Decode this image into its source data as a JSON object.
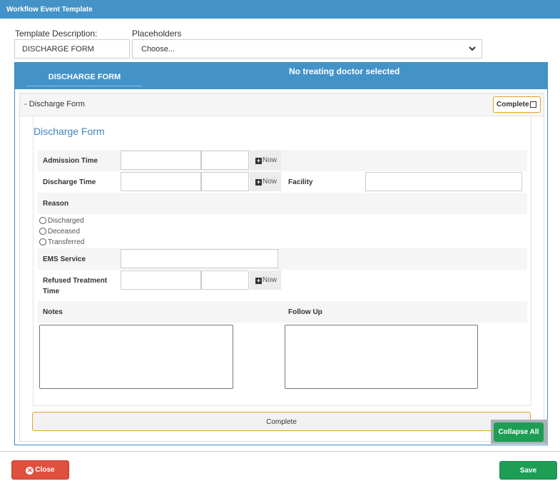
{
  "window": {
    "title": "Workflow Event Template"
  },
  "template": {
    "description_label": "Template Description:",
    "description_value": "DISCHARGE FORM",
    "placeholders_label": "Placeholders",
    "placeholders_value": "Choose..."
  },
  "panel": {
    "tab_label": "DISCHARGE FORM",
    "doctor_status": "No treating doctor selected"
  },
  "form": {
    "header_title": "- Discharge Form",
    "complete_label": "Complete",
    "title": "Discharge Form",
    "fields": {
      "admission_time": "Admission Time",
      "discharge_time": "Discharge Time",
      "facility": "Facility",
      "reason": "Reason",
      "ems_service": "EMS Service",
      "refused_treatment_time": "Refused Treatment Time",
      "notes": "Notes",
      "follow_up": "Follow Up"
    },
    "now_label": "Now",
    "reason_options": [
      "Discharged",
      "Deceased",
      "Transferred"
    ]
  },
  "footer": {
    "complete_label": "Complete",
    "collapse_all_label": "Collapse All",
    "close_label": "Close",
    "save_label": "Save"
  },
  "colors": {
    "header_blue": "#4393c8",
    "accent_orange": "#e8a21b",
    "save_green": "#1e9e55",
    "close_red": "#e0503e",
    "form_title_blue": "#3f86bf"
  }
}
